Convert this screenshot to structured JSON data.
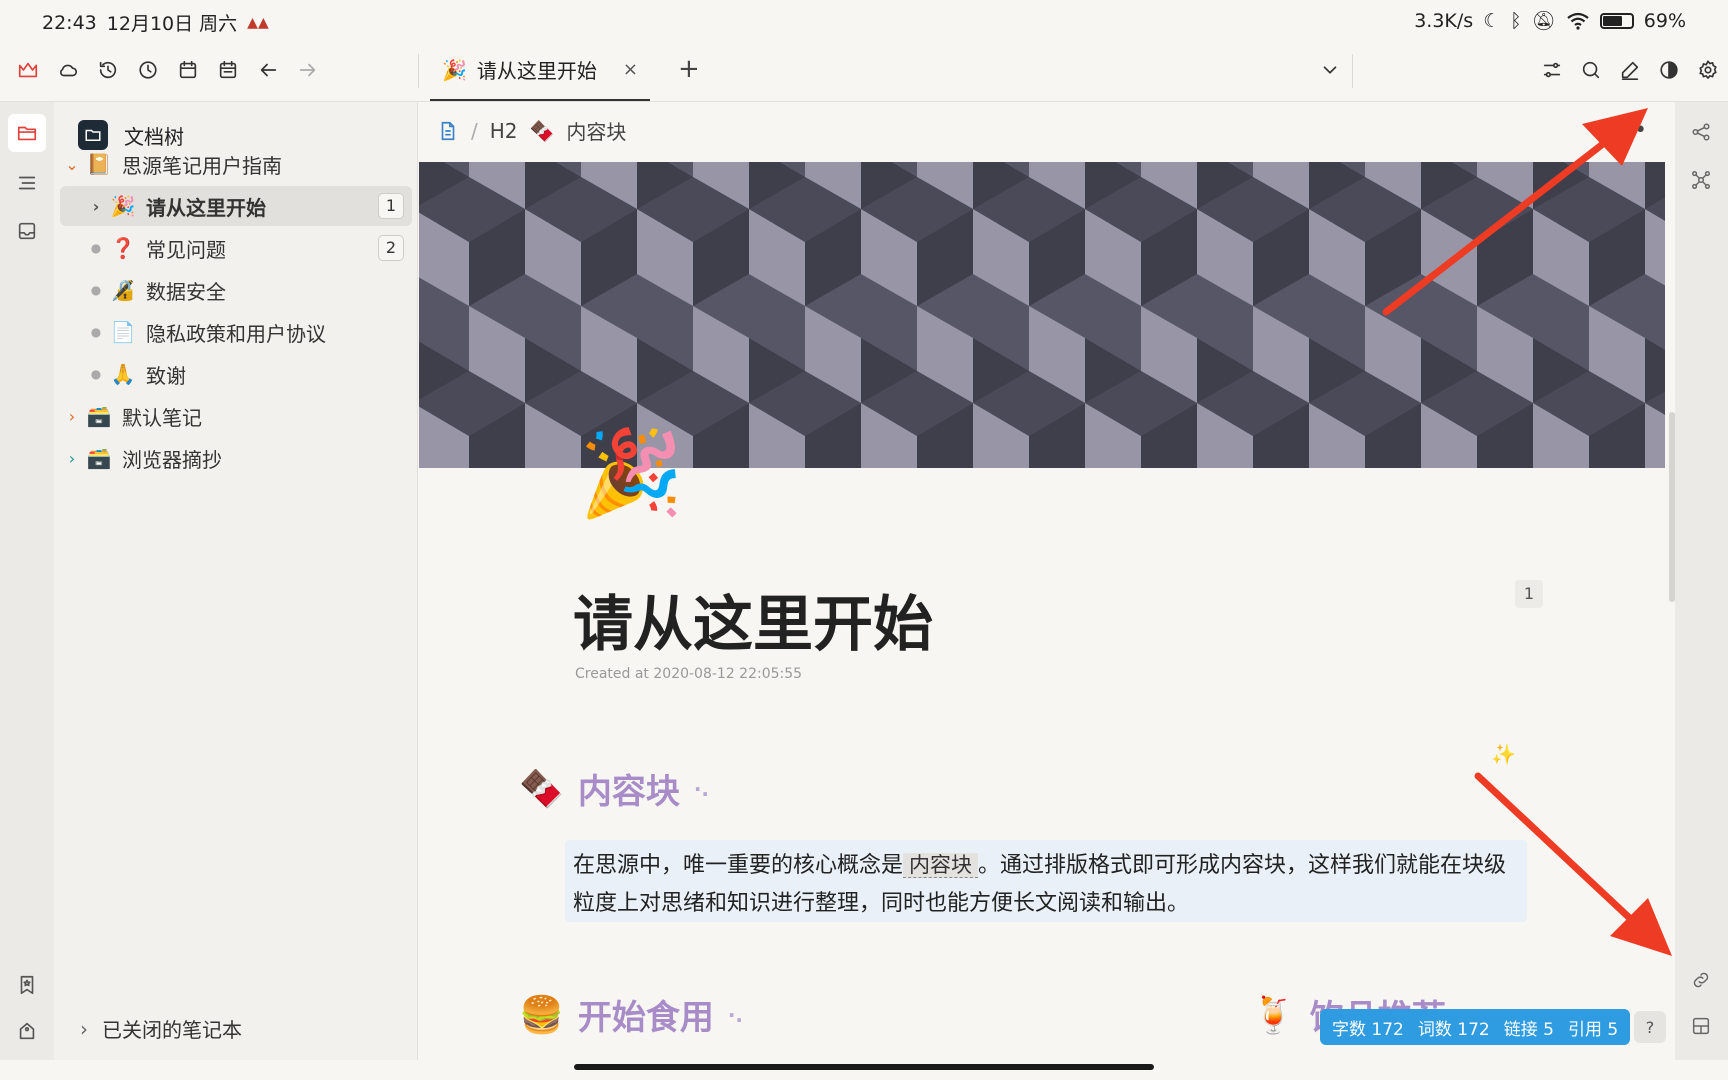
{
  "status_bar": {
    "time": "22:43",
    "date": "12月10日 周六",
    "net_speed": "3.3K/s",
    "battery_pct": "69%",
    "battery_level": 0.69
  },
  "toolbar": {
    "tab_icon": "🎉",
    "tab_title": "请从这里开始",
    "tab_close": "×",
    "tab_add": "+"
  },
  "sidebar": {
    "header": "文档树",
    "notebook1": {
      "icon": "📔",
      "label": "思源笔记用户指南"
    },
    "items": [
      {
        "icon": "🎉",
        "label": "请从这里开始",
        "badge": "1"
      },
      {
        "icon": "❓",
        "label": "常见问题",
        "badge": "2"
      },
      {
        "icon": "🔏",
        "label": "数据安全"
      },
      {
        "icon": "📄",
        "label": "隐私政策和用户协议"
      },
      {
        "icon": "🙏",
        "label": "致谢"
      }
    ],
    "notebook2": {
      "icon": "🗃️",
      "label": "默认笔记"
    },
    "notebook3": {
      "icon": "🗃️",
      "label": "浏览器摘抄"
    },
    "closed_label": "已关闭的笔记本"
  },
  "editor": {
    "breadcrumb_sep": "/",
    "breadcrumb_h2": "H2",
    "breadcrumb_icon": "🍫",
    "breadcrumb_label": "内容块",
    "more": "••",
    "doc_icon": "🎉",
    "title": "请从这里开始",
    "title_badge": "1",
    "created": "Created at 2020-08-12 22:05:55",
    "h2_1": {
      "icon": "🍫",
      "label": "内容块",
      "suffix": "·."
    },
    "para_part1": "在思源中，唯一重要的核心概念是",
    "para_code": "内容块",
    "para_part2": "。通过排版格式即可形成内容块，这样我们就能在块级粒度上对思绪和知识进行整理，同时也能方便长文阅读和输出。",
    "h2_2": {
      "icon": "🍔",
      "label": "开始食用",
      "suffix": "·."
    },
    "h2_3": {
      "icon": "🍹",
      "label": "饮品推荐"
    },
    "sparkle": "✨",
    "help": "?"
  },
  "counts": {
    "chars": "字数 172",
    "words": "词数 172",
    "links": "链接 5",
    "refs": "引用 5"
  },
  "colors": {
    "accent_red": "#e0413a",
    "heading_purple": "#a78cc7",
    "status_blue": "#2f9be0",
    "banner_dark": "#4a4a58",
    "banner_light": "#9a98a8",
    "annotation_arrow": "#ee3b24"
  }
}
